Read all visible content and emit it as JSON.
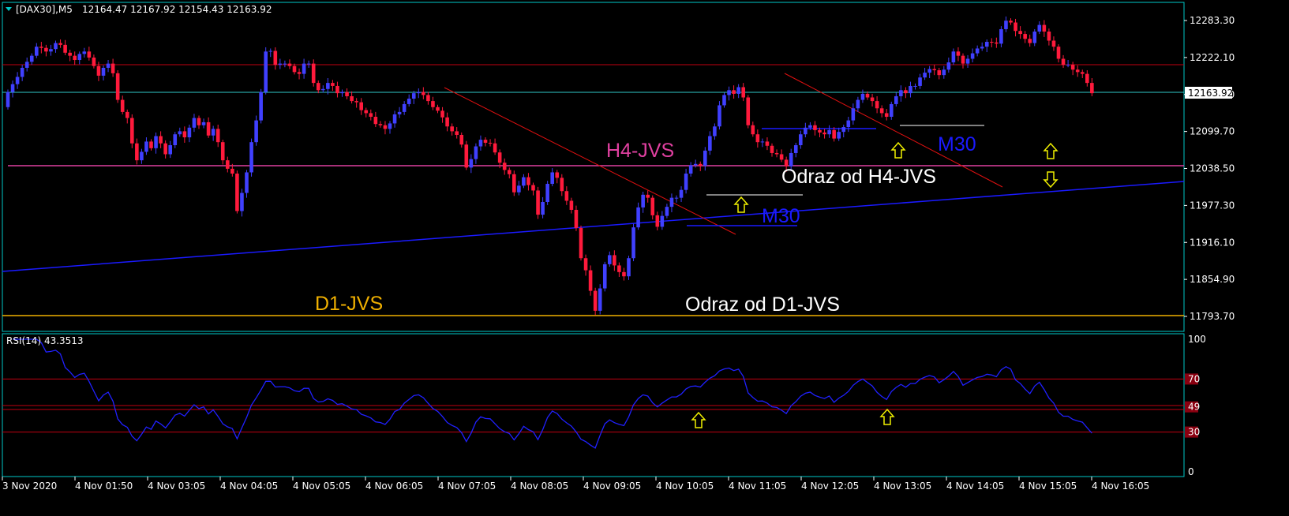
{
  "header": {
    "symbol": "[DAX30],M5",
    "ohlc": "12164.47 12167.92 12154.43 12163.92"
  },
  "rsi_label": "RSI(14) 43.3513",
  "current_price": "12163.92",
  "colors": {
    "background": "#000000",
    "frame": "#00c8c8",
    "bull": "#4040ff",
    "bear": "#ff1a3c",
    "trend_blue": "#1a1aff",
    "trend_red": "#e01010",
    "level_magenta": "#e040a0",
    "level_orange": "#f0b000",
    "level_dark_red": "#c00010",
    "arrow_yellow": "#f0f000",
    "rsi_line": "#2020ff"
  },
  "labels": {
    "h4": "H4-JVS",
    "d1": "D1-JVS",
    "m30_a": "M30",
    "m30_b": "M30",
    "odraz_h4": "Odraz od H4-JVS",
    "odraz_d1": "Odraz od D1-JVS"
  },
  "chart_data": [
    {
      "type": "candlestick",
      "symbol": "DAX30",
      "timeframe": "M5",
      "ylim": [
        11770,
        12300
      ],
      "y_ticks": [
        "12283.30",
        "12222.10",
        "12160.90",
        "12099.70",
        "12038.50",
        "11977.30",
        "11916.10",
        "11854.90",
        "11793.70"
      ],
      "x_ticks": [
        "3 Nov 2020",
        "4 Nov 01:50",
        "4 Nov 03:05",
        "4 Nov 04:05",
        "4 Nov 05:05",
        "4 Nov 06:05",
        "4 Nov 07:05",
        "4 Nov 08:05",
        "4 Nov 09:05",
        "4 Nov 10:05",
        "4 Nov 11:05",
        "4 Nov 12:05",
        "4 Nov 13:05",
        "4 Nov 14:05",
        "4 Nov 15:05",
        "4 Nov 16:05"
      ],
      "closes": [
        12165,
        12178,
        12190,
        12205,
        12215,
        12225,
        12240,
        12238,
        12232,
        12236,
        12246,
        12243,
        12230,
        12225,
        12218,
        12228,
        12232,
        12222,
        12208,
        12192,
        12205,
        12212,
        12196,
        12152,
        12132,
        12122,
        12080,
        12052,
        12066,
        12083,
        12072,
        12092,
        12080,
        12062,
        12077,
        12095,
        12100,
        12090,
        12106,
        12122,
        12110,
        12115,
        12093,
        12104,
        12082,
        12052,
        12038,
        12030,
        11968,
        11998,
        12032,
        12082,
        12118,
        12165,
        12232,
        12233,
        12210,
        12212,
        12212,
        12208,
        12198,
        12195,
        12212,
        12212,
        12180,
        12168,
        12170,
        12180,
        12175,
        12163,
        12165,
        12158,
        12150,
        12148,
        12135,
        12130,
        12124,
        12112,
        12110,
        12104,
        12113,
        12128,
        12132,
        12145,
        12154,
        12163,
        12165,
        12160,
        12150,
        12140,
        12134,
        12123,
        12108,
        12100,
        12094,
        12078,
        12040,
        12054,
        12075,
        12086,
        12081,
        12080,
        12065,
        12048,
        12036,
        12029,
        11999,
        12010,
        12024,
        12011,
        12002,
        11962,
        11983,
        12013,
        12032,
        12023,
        12001,
        11985,
        11970,
        11940,
        11890,
        11870,
        11836,
        11803,
        11840,
        11880,
        11895,
        11878,
        11867,
        11860,
        11890,
        11941,
        11974,
        11995,
        11990,
        11961,
        11942,
        11960,
        11975,
        11990,
        11990,
        12003,
        12030,
        12044,
        12046,
        12043,
        12068,
        12092,
        12108,
        12143,
        12160,
        12168,
        12162,
        12173,
        12156,
        12110,
        12095,
        12082,
        12083,
        12076,
        12064,
        12062,
        12053,
        12042,
        12064,
        12077,
        12095,
        12106,
        12110,
        12102,
        12098,
        12095,
        12102,
        12088,
        12099,
        12107,
        12118,
        12138,
        12152,
        12162,
        12156,
        12150,
        12138,
        12130,
        12124,
        12145,
        12158,
        12168,
        12163,
        12175,
        12175,
        12189,
        12197,
        12203,
        12201,
        12193,
        12202,
        12214,
        12232,
        12225,
        12212,
        12220,
        12229,
        12237,
        12240,
        12248,
        12247,
        12245,
        12269,
        12283,
        12280,
        12266,
        12261,
        12253,
        12246,
        12265,
        12276,
        12265,
        12250,
        12240,
        12220,
        12210,
        12210,
        12202,
        12198,
        12195,
        12180,
        12163
      ]
    },
    {
      "type": "line",
      "title": "RSI(14) 43.3513",
      "ylim": [
        0,
        100
      ],
      "y_ticks": [
        "100",
        "70",
        "49",
        "30",
        "0"
      ],
      "levels": [
        70,
        50,
        47,
        30
      ],
      "value": 43.3513
    }
  ]
}
